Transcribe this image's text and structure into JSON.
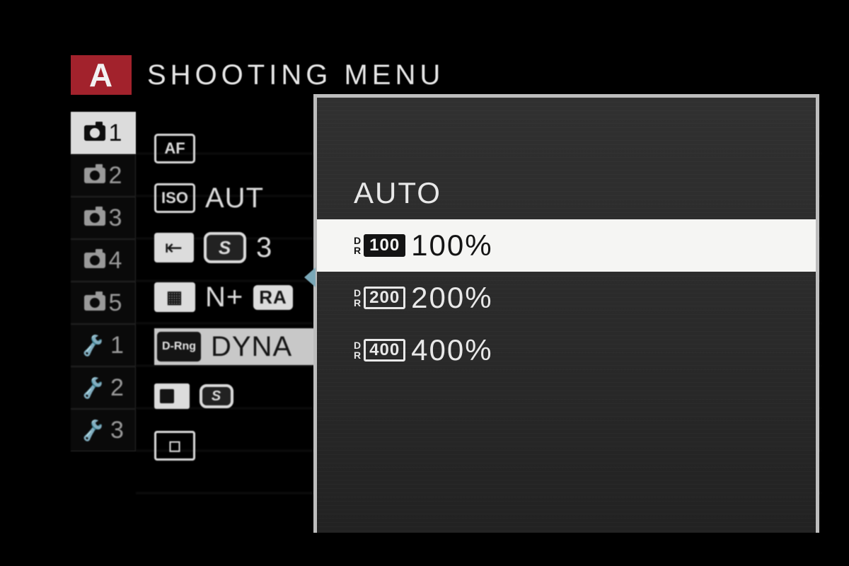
{
  "header": {
    "mode_letter": "A",
    "title": "SHOOTING MENU"
  },
  "tabs": [
    {
      "type": "camera",
      "num": "1",
      "active": true
    },
    {
      "type": "camera",
      "num": "2",
      "active": false
    },
    {
      "type": "camera",
      "num": "3",
      "active": false
    },
    {
      "type": "camera",
      "num": "4",
      "active": false
    },
    {
      "type": "camera",
      "num": "5",
      "active": false
    },
    {
      "type": "wrench",
      "num": "1",
      "active": false
    },
    {
      "type": "wrench",
      "num": "2",
      "active": false
    },
    {
      "type": "wrench",
      "num": "3",
      "active": false
    }
  ],
  "menu": {
    "af_icon": "AF",
    "iso_icon": "ISO",
    "iso_value": "AUT",
    "size_icon": "S",
    "size_value": "3",
    "quality_label": "N+",
    "quality_raw": "RA",
    "drng_icon": "D-Rng",
    "drng_label": "DYNA"
  },
  "popup": {
    "items": [
      {
        "label": "AUTO",
        "dr_num": "",
        "selected": false
      },
      {
        "label": "100%",
        "dr_num": "100",
        "selected": true
      },
      {
        "label": "200%",
        "dr_num": "200",
        "selected": false
      },
      {
        "label": "400%",
        "dr_num": "400",
        "selected": false
      }
    ]
  }
}
